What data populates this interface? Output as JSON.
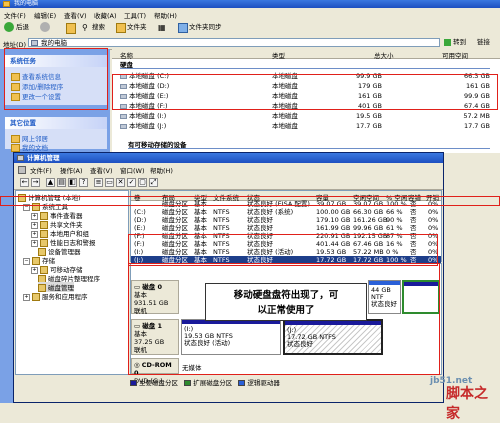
{
  "explorer": {
    "title": "我的电脑",
    "menu": [
      "文件(F)",
      "编辑(E)",
      "查看(V)",
      "收藏(A)",
      "工具(T)",
      "帮助(H)"
    ],
    "toolbar": {
      "back": "后退",
      "search": "搜索",
      "folders": "文件夹",
      "folder_sync": "文件夹同步"
    },
    "address_label": "地址(D)",
    "address_value": "我的电脑",
    "go_label": "转到",
    "links_label": "链接",
    "columns": [
      "名称",
      "类型",
      "总大小",
      "可用空间"
    ],
    "group_hard_disks": "硬盘",
    "group_removable": "有可移动存储的设备",
    "drives": [
      {
        "name": "本地磁盘 (C:)",
        "type": "本地磁盘",
        "total": "99.9 GB",
        "free": "66.3 GB"
      },
      {
        "name": "本地磁盘 (D:)",
        "type": "本地磁盘",
        "total": "179 GB",
        "free": "161 GB"
      },
      {
        "name": "本地磁盘 (E:)",
        "type": "本地磁盘",
        "total": "161 GB",
        "free": "99.9 GB"
      },
      {
        "name": "本地磁盘 (F:)",
        "type": "本地磁盘",
        "total": "401 GB",
        "free": "67.4 GB"
      },
      {
        "name": "本地磁盘 (I:)",
        "type": "本地磁盘",
        "total": "19.5 GB",
        "free": "57.2 MB"
      },
      {
        "name": "本地磁盘 (J:)",
        "type": "本地磁盘",
        "total": "17.7 GB",
        "free": "17.7 GB"
      }
    ],
    "left_panels": [
      {
        "title": "系统任务",
        "items": [
          "查看系统信息",
          "添加/删除程序",
          "更改一个设置"
        ]
      },
      {
        "title": "其它位置",
        "items": [
          "网上邻居",
          "我的文档"
        ]
      }
    ]
  },
  "cm": {
    "title": "计算机管理",
    "menu": [
      "文件(F)",
      "操作(A)",
      "查看(V)",
      "窗口(W)",
      "帮助(H)"
    ],
    "tree": [
      {
        "label": "计算机管理 (本地)",
        "level": 0
      },
      {
        "label": "系统工具",
        "level": 1
      },
      {
        "label": "事件查看器",
        "level": 2
      },
      {
        "label": "共享文件夹",
        "level": 2
      },
      {
        "label": "本地用户和组",
        "level": 2
      },
      {
        "label": "性能日志和警报",
        "level": 2
      },
      {
        "label": "设备管理器",
        "level": 2
      },
      {
        "label": "存储",
        "level": 1
      },
      {
        "label": "可移动存储",
        "level": 2
      },
      {
        "label": "磁盘碎片整理程序",
        "level": 2
      },
      {
        "label": "磁盘管理",
        "level": 2
      },
      {
        "label": "服务和应用程序",
        "level": 1
      }
    ],
    "volume_headers": [
      "卷",
      "布局",
      "类型",
      "文件系统",
      "状态",
      "容量",
      "空闲空间",
      "% 空闲",
      "容错",
      "开销"
    ],
    "volumes": [
      [
        "",
        "磁盘分区",
        "基本",
        "",
        "状态良好 (EISA 配置)",
        "39.07 GB",
        "39.07 GB",
        "100 %",
        "否",
        "0%"
      ],
      [
        "(C:)",
        "磁盘分区",
        "基本",
        "NTFS",
        "状态良好 (系统)",
        "100.00 GB",
        "66.30 GB",
        "66 %",
        "否",
        "0%"
      ],
      [
        "(D:)",
        "磁盘分区",
        "基本",
        "NTFS",
        "状态良好",
        "179.10 GB",
        "161.26 GB",
        "90 %",
        "否",
        "0%"
      ],
      [
        "(E:)",
        "磁盘分区",
        "基本",
        "NTFS",
        "状态良好",
        "161.99 GB",
        "99.96 GB",
        "61 %",
        "否",
        "0%"
      ],
      [
        "(F:)",
        "磁盘分区",
        "基本",
        "NTFS",
        "状态良好",
        "220.91 GB",
        "192.15 GB",
        "87 %",
        "否",
        "0%"
      ],
      [
        "(F:)",
        "磁盘分区",
        "基本",
        "NTFS",
        "状态良好",
        "401.44 GB",
        "67.46 GB",
        "16 %",
        "否",
        "0%"
      ],
      [
        "(I:)",
        "磁盘分区",
        "基本",
        "NTFS",
        "状态良好 (活动)",
        "19.53 GB",
        "57.22 MB",
        "0 %",
        "否",
        "0%"
      ],
      [
        "(J:)",
        "磁盘分区",
        "基本",
        "NTFS",
        "状态良好",
        "17.72 GB",
        "17.72 GB",
        "100 %",
        "否",
        "0%"
      ]
    ],
    "disk0": {
      "label": "磁盘 0",
      "type": "基本",
      "size": "931.51 GB",
      "status": "联机",
      "part_size": "44 GB NTF",
      "part_status": "状态良好"
    },
    "disk1": {
      "label": "磁盘 1",
      "type": "基本",
      "size": "37.25 GB",
      "status": "联机",
      "part_i": {
        "name": "(I:)",
        "size": "19.53 GB",
        "fs": "NTFS",
        "status": "状态良好 (活动)"
      },
      "part_j": {
        "name": "(J:)",
        "size": "17.72 GB",
        "fs": "NTFS",
        "status": "状态良好"
      }
    },
    "cdrom": {
      "label": "CD-ROM 0",
      "type": "DVD (G:)",
      "status": "无媒体"
    },
    "legend": [
      "主要磁盘分区",
      "扩展磁盘分区",
      "逻辑驱动器"
    ],
    "legend_colors": [
      "#1a1a9a",
      "#2e8b2e",
      "#2a60d8"
    ]
  },
  "callout": {
    "line1": "移动硬盘盘符出现了，可",
    "line2": "以正常使用了"
  },
  "watermark": {
    "site": "jb51.net",
    "brand": "脚本之家"
  }
}
